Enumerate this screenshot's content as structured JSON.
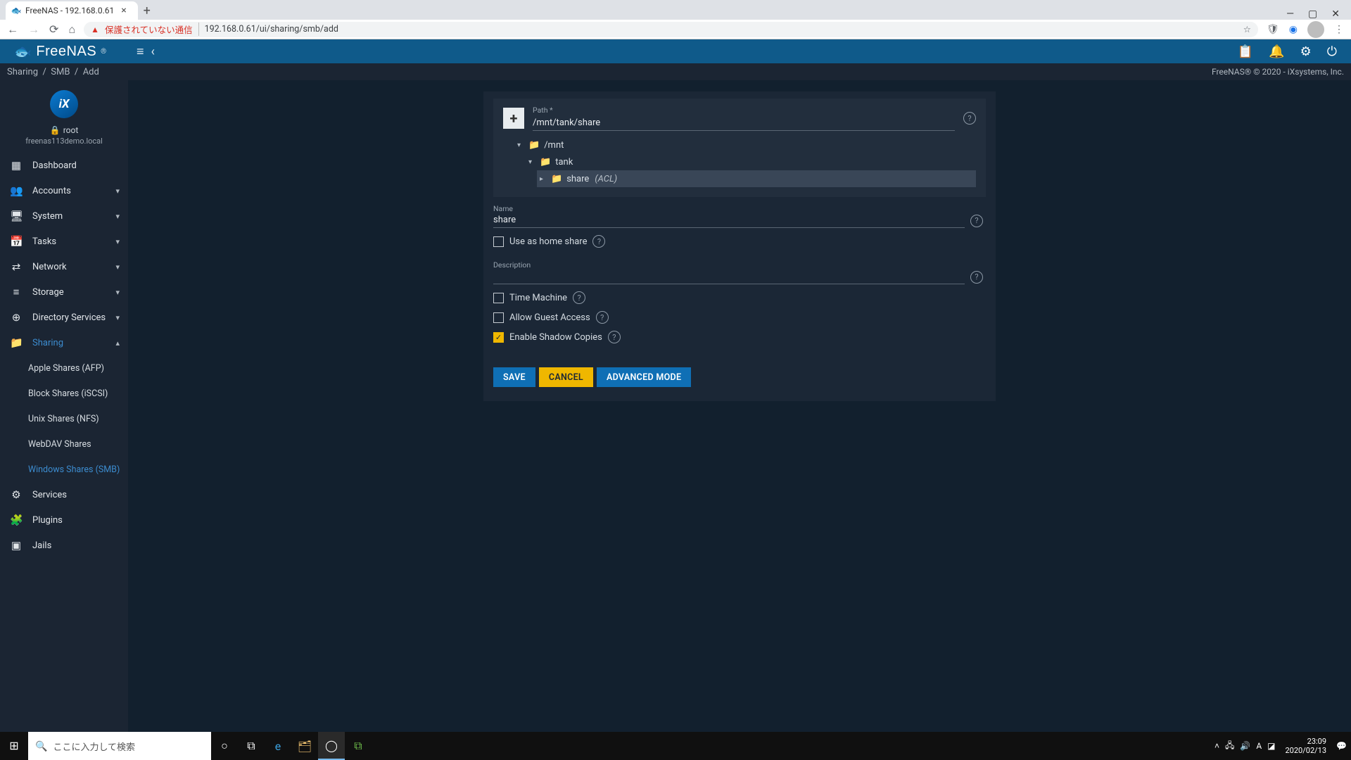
{
  "browser": {
    "tab_title": "FreeNAS - 192.168.0.61",
    "insecure_label": "保護されていない通信",
    "url": "192.168.0.61/ui/sharing/smb/add"
  },
  "app": {
    "brand": "FreeNAS",
    "copyright": "FreeNAS® © 2020 - iXsystems, Inc.",
    "breadcrumb": [
      "Sharing",
      "SMB",
      "Add"
    ]
  },
  "sidebar": {
    "ix": "iX",
    "user": "root",
    "host": "freenas113demo.local",
    "items": [
      {
        "icon": "▦",
        "label": "Dashboard",
        "expand": false
      },
      {
        "icon": "👥",
        "label": "Accounts",
        "expand": true
      },
      {
        "icon": "🖥",
        "label": "System",
        "expand": true
      },
      {
        "icon": "📅",
        "label": "Tasks",
        "expand": true
      },
      {
        "icon": "⇄",
        "label": "Network",
        "expand": true
      },
      {
        "icon": "≡",
        "label": "Storage",
        "expand": true
      },
      {
        "icon": "⊕",
        "label": "Directory Services",
        "expand": true
      },
      {
        "icon": "📁",
        "label": "Sharing",
        "expand": true,
        "active": true
      },
      {
        "icon": "⚙",
        "label": "Services",
        "expand": false
      },
      {
        "icon": "🧩",
        "label": "Plugins",
        "expand": false
      },
      {
        "icon": "▣",
        "label": "Jails",
        "expand": false
      }
    ],
    "sharing_sub": [
      {
        "label": "Apple Shares (AFP)"
      },
      {
        "label": "Block Shares (iSCSI)"
      },
      {
        "label": "Unix Shares (NFS)"
      },
      {
        "label": "WebDAV Shares"
      },
      {
        "label": "Windows Shares (SMB)",
        "active": true
      }
    ]
  },
  "form": {
    "path_label": "Path *",
    "path_value": "/mnt/tank/share",
    "tree": {
      "root": "/mnt",
      "level1": "tank",
      "level2": "share",
      "level2_suffix": "(ACL)"
    },
    "name_label": "Name",
    "name_value": "share",
    "use_home_label": "Use as home share",
    "desc_label": "Description",
    "desc_value": "",
    "time_machine_label": "Time Machine",
    "guest_label": "Allow Guest Access",
    "shadow_label": "Enable Shadow Copies",
    "checks": {
      "home": false,
      "time_machine": false,
      "guest": false,
      "shadow": true
    },
    "buttons": {
      "save": "SAVE",
      "cancel": "CANCEL",
      "advanced": "ADVANCED MODE"
    }
  },
  "taskbar": {
    "search_placeholder": "ここに入力して検索",
    "time": "23:09",
    "date": "2020/02/13"
  }
}
